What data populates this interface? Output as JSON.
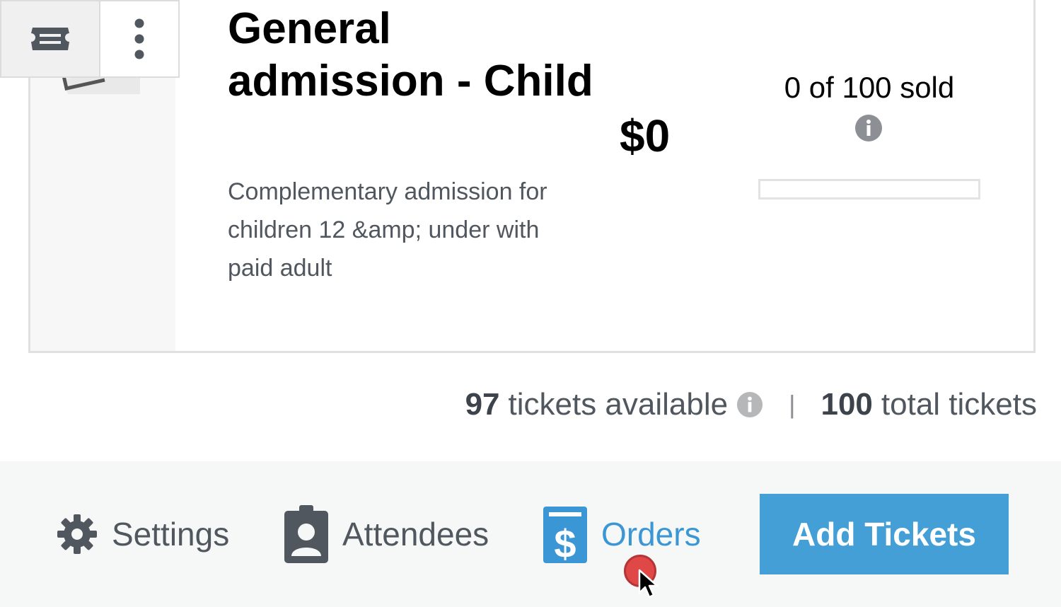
{
  "ticket": {
    "name": "General admission - Child",
    "description": "Complementary admission for children 12 &amp; under with paid adult",
    "price": "$0",
    "sold_text": "0 of 100 sold",
    "sold_fraction": 0
  },
  "summary": {
    "available_count": "97",
    "available_label": "tickets available",
    "separator": "|",
    "total_count": "100",
    "total_label": "total tickets"
  },
  "footer": {
    "settings_label": "Settings",
    "attendees_label": "Attendees",
    "orders_label": "Orders",
    "add_tickets_label": "Add Tickets"
  },
  "colors": {
    "accent": "#449fd6",
    "orders_link": "#3a96d4",
    "muted_text": "#50575e"
  }
}
